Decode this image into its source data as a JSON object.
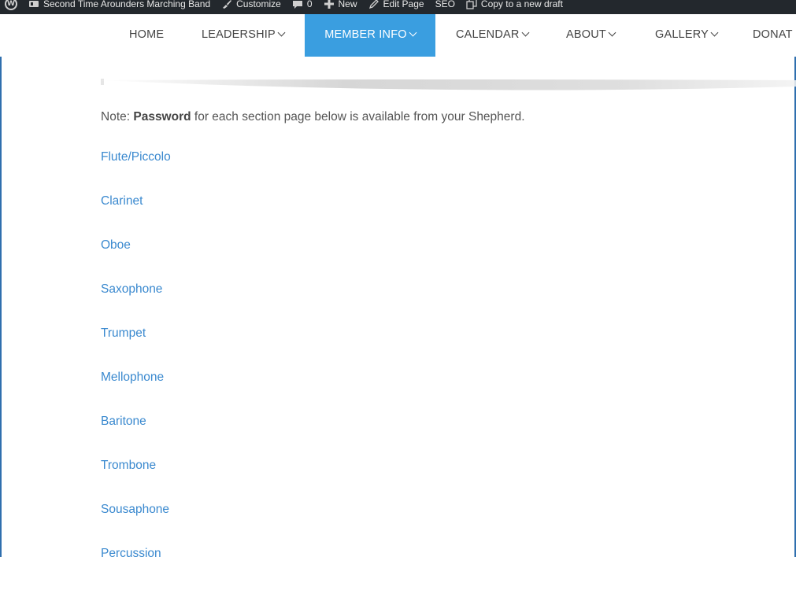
{
  "adminbar": {
    "wp_logo": "W",
    "site_name": "Second Time Arounders Marching Band",
    "customize": "Customize",
    "comments_count": "0",
    "new": "New",
    "edit_page": "Edit Page",
    "seo": "SEO",
    "copy_draft": "Copy to a new draft"
  },
  "nav": {
    "items": [
      {
        "label": "HOME",
        "has_dropdown": false
      },
      {
        "label": "LEADERSHIP",
        "has_dropdown": true
      },
      {
        "label": "MEMBER INFO",
        "has_dropdown": true,
        "active": true
      },
      {
        "label": "CALENDAR",
        "has_dropdown": true
      },
      {
        "label": "ABOUT",
        "has_dropdown": true
      },
      {
        "label": "GALLERY",
        "has_dropdown": true
      },
      {
        "label": "DONAT",
        "has_dropdown": false
      }
    ],
    "active_color": "#3a9ee0"
  },
  "content": {
    "note_prefix": "Note: ",
    "note_bold": "Password",
    "note_rest": " for each section page below is available from your Shepherd.",
    "sections": [
      "Flute/Piccolo",
      "Clarinet",
      "Oboe",
      "Saxophone",
      "Trumpet",
      "Mellophone",
      "Baritone",
      "Trombone",
      "Sousaphone",
      "Percussion"
    ],
    "link_color": "#3a89cf"
  }
}
